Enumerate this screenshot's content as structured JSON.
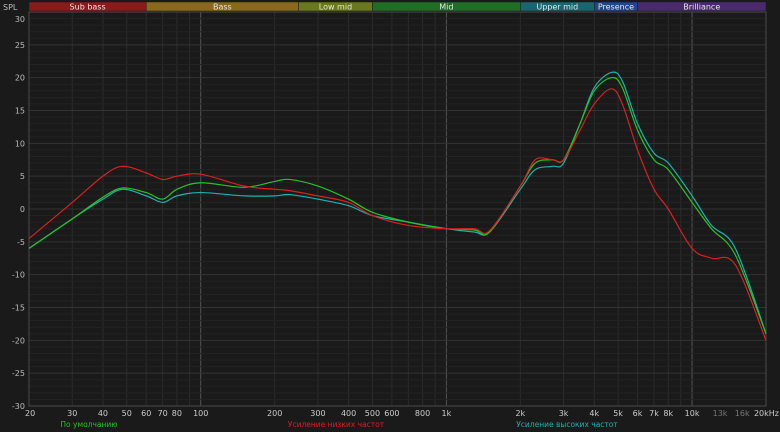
{
  "chart_data": {
    "type": "line",
    "xscale": "log",
    "xlim": [
      20,
      20000
    ],
    "ylim": [
      -30,
      30
    ],
    "ylabel": "SPL",
    "grid": true,
    "yticks": [
      30,
      25,
      20,
      15,
      10,
      5,
      0,
      -5,
      -10,
      -15,
      -20,
      -25,
      -30
    ],
    "xticks": [
      {
        "v": 20,
        "label": "20"
      },
      {
        "v": 30,
        "label": "30"
      },
      {
        "v": 40,
        "label": "40"
      },
      {
        "v": 50,
        "label": "50"
      },
      {
        "v": 60,
        "label": "60"
      },
      {
        "v": 70,
        "label": "70"
      },
      {
        "v": 80,
        "label": "80"
      },
      {
        "v": 100,
        "label": "100"
      },
      {
        "v": 200,
        "label": "200"
      },
      {
        "v": 300,
        "label": "300"
      },
      {
        "v": 400,
        "label": "400"
      },
      {
        "v": 500,
        "label": "500"
      },
      {
        "v": 600,
        "label": "600"
      },
      {
        "v": 800,
        "label": "800"
      },
      {
        "v": 1000,
        "label": "1k"
      },
      {
        "v": 2000,
        "label": "2k"
      },
      {
        "v": 3000,
        "label": "3k"
      },
      {
        "v": 4000,
        "label": "4k"
      },
      {
        "v": 5000,
        "label": "5k"
      },
      {
        "v": 6000,
        "label": "6k"
      },
      {
        "v": 7000,
        "label": "7k"
      },
      {
        "v": 8000,
        "label": "8k"
      },
      {
        "v": 10000,
        "label": "10k"
      },
      {
        "v": 13000,
        "label": "13k",
        "dim": true
      },
      {
        "v": 16000,
        "label": "16k",
        "dim": true
      },
      {
        "v": 20000,
        "label": "20kHz"
      }
    ],
    "bands": [
      {
        "label": "Sub bass",
        "from": 20,
        "to": 60,
        "color": "#8b1a1a"
      },
      {
        "label": "Bass",
        "from": 60,
        "to": 250,
        "color": "#8a6a1a"
      },
      {
        "label": "Low mid",
        "from": 250,
        "to": 500,
        "color": "#6a7a1a"
      },
      {
        "label": "Mid",
        "from": 500,
        "to": 2000,
        "color": "#1f6e24"
      },
      {
        "label": "Upper mid",
        "from": 2000,
        "to": 4000,
        "color": "#1a6670"
      },
      {
        "label": "Presence",
        "from": 4000,
        "to": 6000,
        "color": "#23468a"
      },
      {
        "label": "Brilliance",
        "from": 6000,
        "to": 20000,
        "color": "#4a2a6e"
      }
    ],
    "series": [
      {
        "name": "По умолчанию",
        "color": "#22c422",
        "x": [
          20,
          30,
          40,
          48,
          60,
          70,
          80,
          100,
          150,
          200,
          230,
          300,
          400,
          500,
          700,
          1000,
          1300,
          1500,
          2000,
          2300,
          2700,
          3000,
          3500,
          4000,
          4700,
          5200,
          6000,
          7000,
          8000,
          10000,
          12000,
          15000,
          20000
        ],
        "y": [
          -6,
          -1.5,
          1.8,
          3.2,
          2.5,
          1.5,
          3,
          4,
          3.3,
          4.2,
          4.5,
          3.5,
          1.5,
          -0.5,
          -2,
          -3,
          -3.2,
          -3.5,
          3.5,
          7,
          7.5,
          7.5,
          13,
          18,
          20,
          18.5,
          12,
          7.5,
          6,
          1,
          -3,
          -7,
          -19
        ]
      },
      {
        "name": "Усиление низких частот",
        "color": "#dd1f1f",
        "x": [
          20,
          30,
          40,
          48,
          60,
          70,
          80,
          100,
          150,
          200,
          230,
          300,
          400,
          500,
          700,
          1000,
          1300,
          1500,
          2000,
          2300,
          2700,
          3000,
          3500,
          4000,
          4700,
          5200,
          6000,
          7000,
          8000,
          10000,
          12000,
          15000,
          20000
        ],
        "y": [
          -4.5,
          1,
          5,
          6.5,
          5.5,
          4.5,
          5,
          5.3,
          3.5,
          3,
          2.8,
          2,
          1,
          -1,
          -2.5,
          -3,
          -3,
          -3.3,
          3.5,
          7.5,
          7.5,
          7.5,
          12,
          16,
          18.3,
          16,
          9,
          3,
          0,
          -6,
          -7.5,
          -8.5,
          -20
        ]
      },
      {
        "name": "Усиление высоких частот",
        "color": "#1fb0b0",
        "x": [
          20,
          30,
          40,
          48,
          60,
          70,
          80,
          100,
          150,
          200,
          230,
          300,
          400,
          500,
          700,
          1000,
          1300,
          1500,
          2000,
          2300,
          2700,
          3000,
          3500,
          4000,
          4700,
          5200,
          6000,
          7000,
          8000,
          10000,
          12000,
          15000,
          20000
        ],
        "y": [
          -6,
          -1.5,
          1.5,
          3,
          2,
          1,
          2,
          2.5,
          2,
          2,
          2.2,
          1.5,
          0.5,
          -1,
          -2,
          -3,
          -3.5,
          -3.5,
          3,
          6,
          6.5,
          7,
          13,
          18.5,
          20.8,
          19.5,
          13,
          8.5,
          7,
          2,
          -2.5,
          -6,
          -19
        ]
      }
    ]
  }
}
